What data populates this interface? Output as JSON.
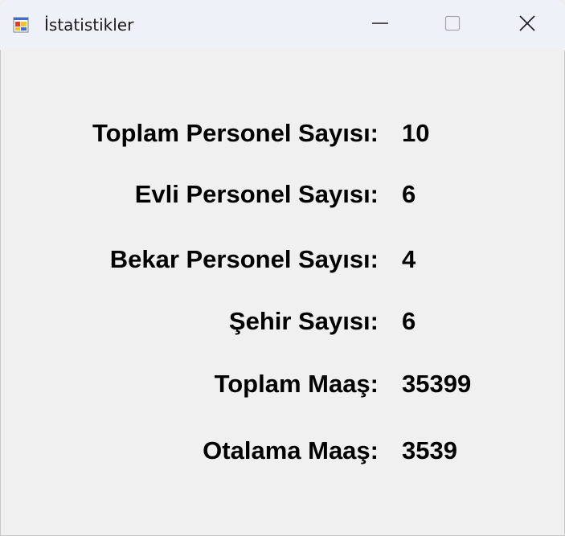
{
  "window": {
    "title": "İstatistikler",
    "icon": "app-form-icon",
    "controls": {
      "minimize_icon": "minimize-icon",
      "maximize_icon": "maximize-icon",
      "close_icon": "close-icon"
    }
  },
  "stats": [
    {
      "label": "Toplam Personel Sayısı:",
      "value": "10"
    },
    {
      "label": "Evli Personel Sayısı:",
      "value": "6"
    },
    {
      "label": "Bekar Personel Sayısı:",
      "value": "4"
    },
    {
      "label": "Şehir Sayısı:",
      "value": "6"
    },
    {
      "label": "Toplam Maaş:",
      "value": "35399"
    },
    {
      "label": "Otalama Maaş:",
      "value": "3539"
    }
  ]
}
